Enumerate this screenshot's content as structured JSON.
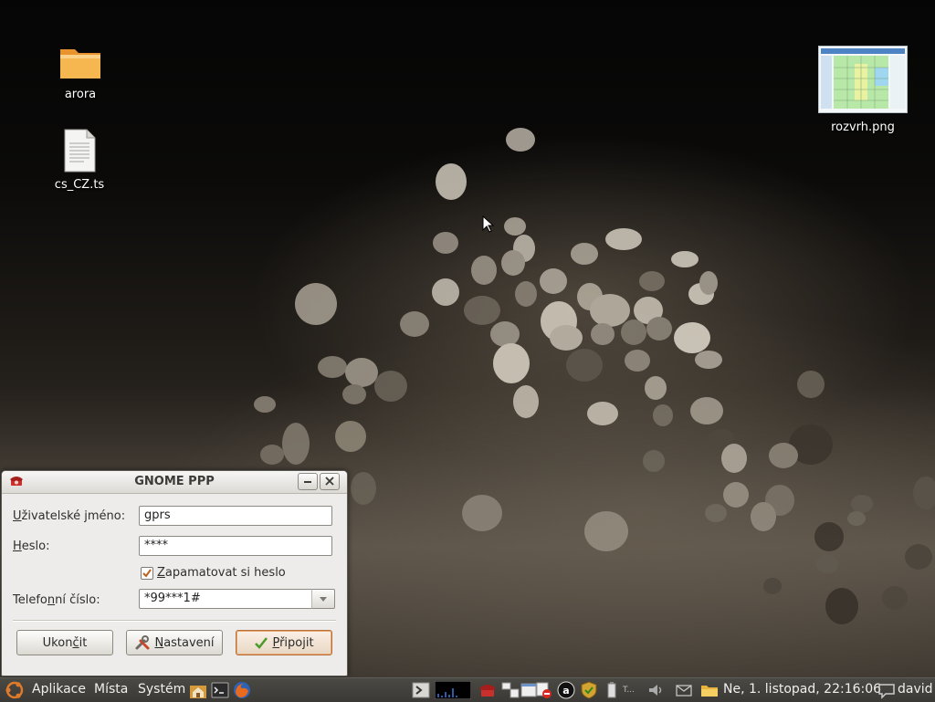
{
  "desktop": {
    "icons": [
      {
        "label": "arora",
        "type": "folder"
      },
      {
        "label": "cs_CZ.ts",
        "type": "text-file"
      },
      {
        "label": "rozvrh.png",
        "type": "image-file"
      }
    ]
  },
  "dialog": {
    "title": "GNOME PPP",
    "username": {
      "label_pre": "U",
      "label_rest": "živatelské jméno:",
      "value": "gprs"
    },
    "password": {
      "label_pre": "H",
      "label_rest": "eslo:",
      "value": "****"
    },
    "remember": {
      "label_pre": "Z",
      "label_rest": "apamatovat si heslo",
      "checked": true
    },
    "phone": {
      "label_pre": "Telefo",
      "label_u": "n",
      "label_rest": "ní číslo:",
      "value": "*99***1#"
    },
    "buttons": {
      "quit": {
        "pre": "Ukon",
        "u": "č",
        "rest": "it"
      },
      "settings": {
        "u": "N",
        "rest": "astavení"
      },
      "connect": {
        "u": "P",
        "rest": "řipojit"
      }
    }
  },
  "panel": {
    "menus": [
      "Aplikace",
      "Místa",
      "Systém"
    ],
    "clock": "Ne,  1. listopad, 22:16:06",
    "user": "david",
    "tray_hint": "T..."
  },
  "colors": {
    "panel_bg": "#3f3e3a",
    "dialog_bg": "#edeceb",
    "accent": "#e07a2b"
  }
}
